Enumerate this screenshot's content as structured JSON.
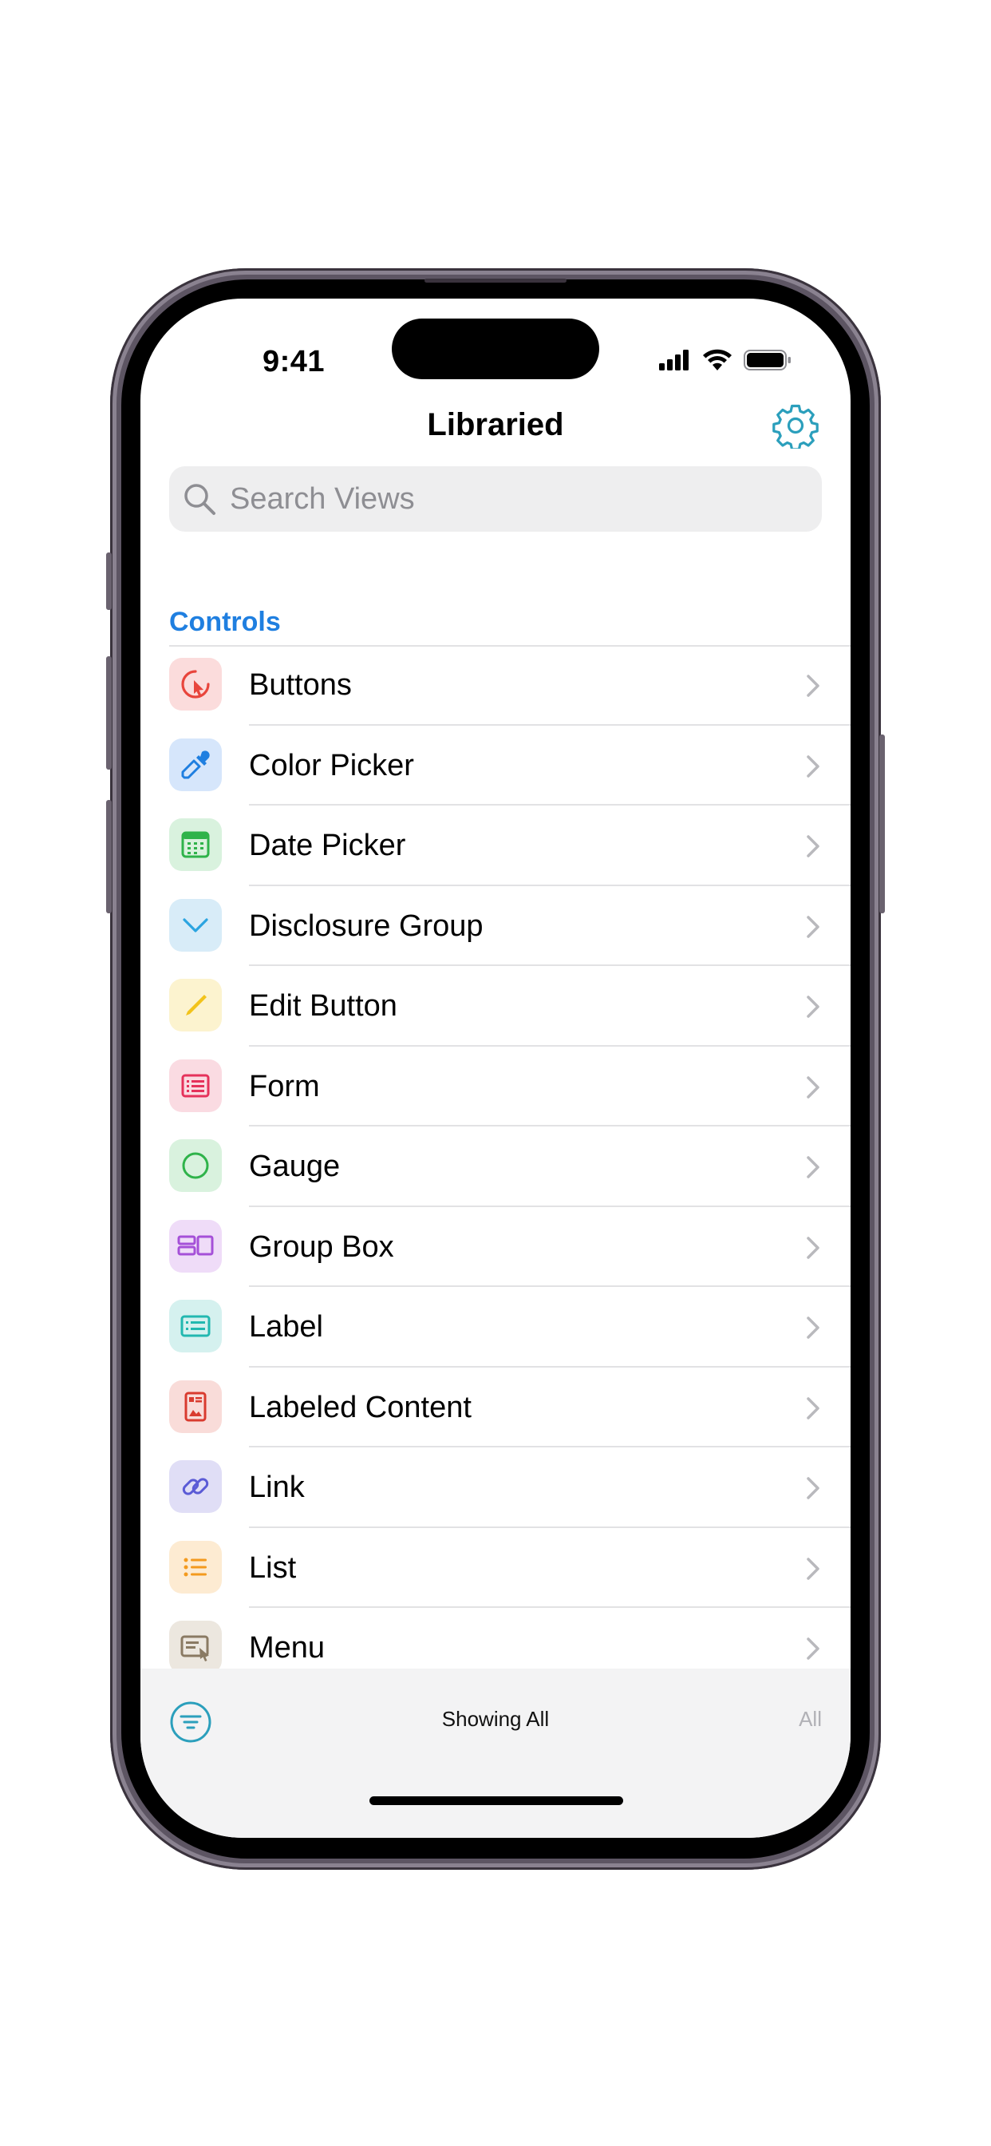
{
  "status_bar": {
    "time": "9:41"
  },
  "nav": {
    "title": "Libraried"
  },
  "search": {
    "placeholder": "Search Views",
    "value": ""
  },
  "section": {
    "title": "Controls"
  },
  "list": [
    {
      "label": "Buttons",
      "icon": "cursor-click-icon",
      "color": "#e8453c",
      "tint": "#fbdcdc"
    },
    {
      "label": "Color Picker",
      "icon": "eyedropper-icon",
      "color": "#1f7fe0",
      "tint": "#d6e6fb"
    },
    {
      "label": "Date Picker",
      "icon": "calendar-icon",
      "color": "#2fb34a",
      "tint": "#d9f2de"
    },
    {
      "label": "Disclosure Group",
      "icon": "chevron-down-icon",
      "color": "#2ba4e0",
      "tint": "#d8ecf8"
    },
    {
      "label": "Edit Button",
      "icon": "pencil-icon",
      "color": "#f2c31b",
      "tint": "#fcf3cf"
    },
    {
      "label": "Form",
      "icon": "form-icon",
      "color": "#e5325b",
      "tint": "#fadbe2"
    },
    {
      "label": "Gauge",
      "icon": "circle-icon",
      "color": "#2fb34a",
      "tint": "#d9f2de"
    },
    {
      "label": "Group Box",
      "icon": "group-box-icon",
      "color": "#a550d8",
      "tint": "#efdcf8"
    },
    {
      "label": "Label",
      "icon": "label-icon",
      "color": "#22b8b0",
      "tint": "#d5f1ef"
    },
    {
      "label": "Labeled Content",
      "icon": "labeled-content-icon",
      "color": "#d93b2f",
      "tint": "#f9dcd9"
    },
    {
      "label": "Link",
      "icon": "link-icon",
      "color": "#5b5bd6",
      "tint": "#e0def6"
    },
    {
      "label": "List",
      "icon": "list-bullet-icon",
      "color": "#f39a1e",
      "tint": "#fdebd2"
    },
    {
      "label": "Menu",
      "icon": "menu-icon",
      "color": "#8a7a63",
      "tint": "#ece7df"
    }
  ],
  "toolbar": {
    "status": "Showing All",
    "filter_value": "All"
  }
}
